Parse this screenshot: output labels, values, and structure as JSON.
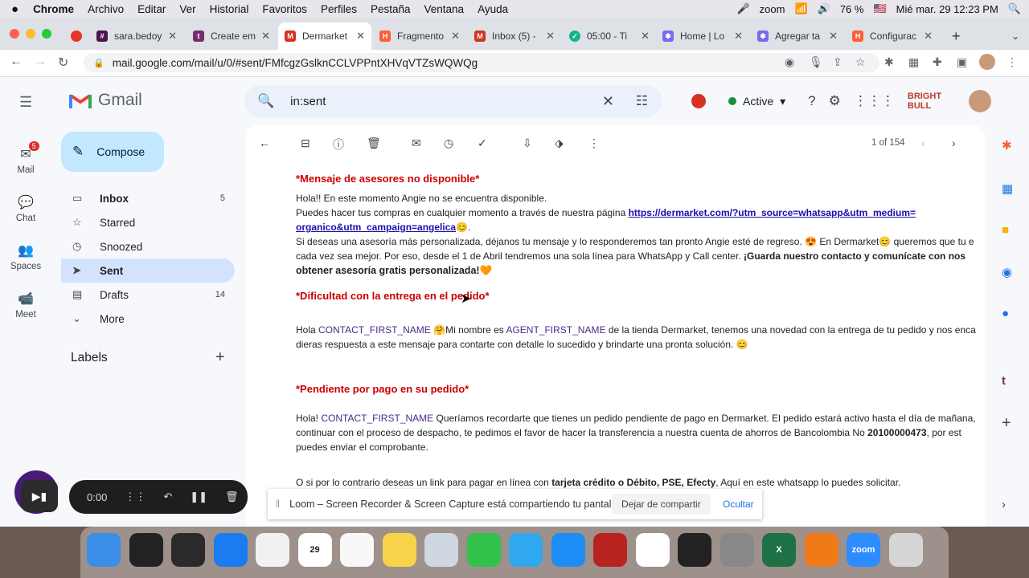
{
  "menubar": {
    "apple": "",
    "items": [
      "Chrome",
      "Archivo",
      "Editar",
      "Ver",
      "Historial",
      "Favoritos",
      "Perfiles",
      "Pestaña",
      "Ventana",
      "Ayuda"
    ],
    "zoom": "zoom",
    "battery": "76 %",
    "clock": "Mié mar. 29  12:23 PM"
  },
  "tabs": [
    {
      "label": "",
      "icon": "record-icon",
      "color": "#e8342b"
    },
    {
      "label": "sara.bedoy",
      "icon": "slack-icon",
      "color": "#4a154b"
    },
    {
      "label": "Create em",
      "icon": "t-icon",
      "color": "#7a2b6d"
    },
    {
      "label": "Dermarket",
      "icon": "gmail-icon",
      "color": "#d93025",
      "active": true
    },
    {
      "label": "Fragmento",
      "icon": "hubspot-icon",
      "color": "#ff5c35"
    },
    {
      "label": "Inbox (5) -",
      "icon": "gmail-icon",
      "color": "#d93025"
    },
    {
      "label": "05:00 - Ti",
      "icon": "check-icon",
      "color": "#13b38b"
    },
    {
      "label": "Home | Lo",
      "icon": "clickup-icon",
      "color": "#7b68ee"
    },
    {
      "label": "Agregar ta",
      "icon": "clickup-icon",
      "color": "#7b68ee"
    },
    {
      "label": "Configurac",
      "icon": "hubspot-icon",
      "color": "#ff5c35"
    }
  ],
  "address": {
    "url": "mail.google.com/mail/u/0/#sent/FMfcgzGslknCCLVPPntXHVqVTZsWQWQg"
  },
  "gmail": {
    "app_name": "Gmail",
    "search_query": "in:sent",
    "status": "Active",
    "brand": "BRIGHT BULL",
    "compose_label": "Compose",
    "rail": [
      {
        "label": "Mail",
        "badge": "5"
      },
      {
        "label": "Chat"
      },
      {
        "label": "Spaces"
      },
      {
        "label": "Meet"
      }
    ],
    "folders": [
      {
        "label": "Inbox",
        "count": "5"
      },
      {
        "label": "Starred",
        "count": ""
      },
      {
        "label": "Snoozed",
        "count": ""
      },
      {
        "label": "Sent",
        "count": ""
      },
      {
        "label": "Drafts",
        "count": "14"
      },
      {
        "label": "More",
        "count": ""
      }
    ],
    "labels_heading": "Labels",
    "pagination": "1 of 154"
  },
  "message": {
    "s1_title": "*Mensaje de asesores no disponible*",
    "s1_l1": "Hola!! En este momento Angie no se encuentra disponible.",
    "s1_l2a": "Puedes hacer tus compras en cualquier momento a través de nuestra página ",
    "s1_link1": "https://dermarket.com/?utm_source=whatsapp&utm_medium=",
    "s1_link2": "organico&utm_campaign=angelica",
    "s1_l3": "Si deseas una asesoría más personalizada, déjanos tu mensaje y lo responderemos tan pronto Angie esté de regreso. 😍 En Dermarket😊 queremos que tu e",
    "s1_l4a": "cada vez sea mejor. Por eso, desde el 1 de Abril tendremos una sola línea para WhatsApp y Call center. ",
    "s1_l4b": "¡Guarda nuestro contacto y comunícate con nos",
    "s1_l5": "obtener asesoría gratis personalizada!🧡",
    "s2_title": "*Dificultad con la entrega en el pedido*",
    "s2_hola": "Hola ",
    "s2_var1": "CONTACT_FIRST_NAME",
    "s2_mid": " 🤗Mi nombre es  ",
    "s2_var2": "AGENT_FIRST_NAME",
    "s2_rest": " de la tienda Dermarket, tenemos una novedad con la entrega de tu pedido y nos encan",
    "s2_l2": "dieras respuesta a este mensaje para contarte con detalle lo sucedido y brindarte una pronta solución. 😊",
    "s3_title": "*Pendiente por pago en su pedido*",
    "s3_hola": "Hola!  ",
    "s3_var": "CONTACT_FIRST_NAME",
    "s3_rest": " Queríamos recordarte que tienes un pedido pendiente de pago en Dermarket. El pedido estará activo hasta el día de mañana,",
    "s3_l2a": "continuar con el proceso de despacho, te pedimos el favor de hacer la transferencia a nuestra cuenta de ahorros de Bancolombia No ",
    "s3_acct": "20100000473",
    "s3_l2b": ", por est",
    "s3_l3": "puedes enviar el comprobante.",
    "s4_a": "O si por lo contrario deseas un link para pagar en línea con ",
    "s4_b": "tarjeta crédito o Débito, PSE, Efecty",
    "s4_c": ", Aquí en este whatsapp lo puedes solicitar."
  },
  "recorder": {
    "timer": "0:00"
  },
  "loom": {
    "message": "Loom – Screen Recorder & Screen Capture está compartiendo tu pantalla.",
    "stop": "Dejar de compartir",
    "hide": "Ocultar"
  },
  "dock": [
    {
      "name": "finder-icon",
      "color": "#3a8ee6",
      "label": ""
    },
    {
      "name": "siri-icon",
      "color": "#222",
      "label": ""
    },
    {
      "name": "mission-control-icon",
      "color": "#2a2a2a",
      "label": ""
    },
    {
      "name": "safari-icon",
      "color": "#1a7cf0",
      "label": ""
    },
    {
      "name": "chrome-icon",
      "color": "#f1f1f1",
      "label": ""
    },
    {
      "name": "calendar-icon",
      "color": "#fff",
      "label": "29"
    },
    {
      "name": "reminders-icon",
      "color": "#f8f8f8",
      "label": ""
    },
    {
      "name": "notes-icon",
      "color": "#f7d34a",
      "label": ""
    },
    {
      "name": "preview-icon",
      "color": "#cfd8e0",
      "label": ""
    },
    {
      "name": "facetime-icon",
      "color": "#32c14a",
      "label": ""
    },
    {
      "name": "messages-icon",
      "color": "#2fa8f0",
      "label": ""
    },
    {
      "name": "app-store-icon",
      "color": "#1d8cf5",
      "label": ""
    },
    {
      "name": "photo-booth-icon",
      "color": "#b8221f",
      "label": ""
    },
    {
      "name": "photos-icon",
      "color": "#fff",
      "label": ""
    },
    {
      "name": "piano-icon",
      "color": "#222",
      "label": ""
    },
    {
      "name": "system-preferences-icon",
      "color": "#888",
      "label": ""
    },
    {
      "name": "excel-icon",
      "color": "#1e7145",
      "label": "X"
    },
    {
      "name": "books-icon",
      "color": "#f07a17",
      "label": ""
    },
    {
      "name": "zoom-icon",
      "color": "#2d8cff",
      "label": "zoom"
    },
    {
      "name": "trash-icon",
      "color": "#d6d6d6",
      "label": ""
    }
  ]
}
